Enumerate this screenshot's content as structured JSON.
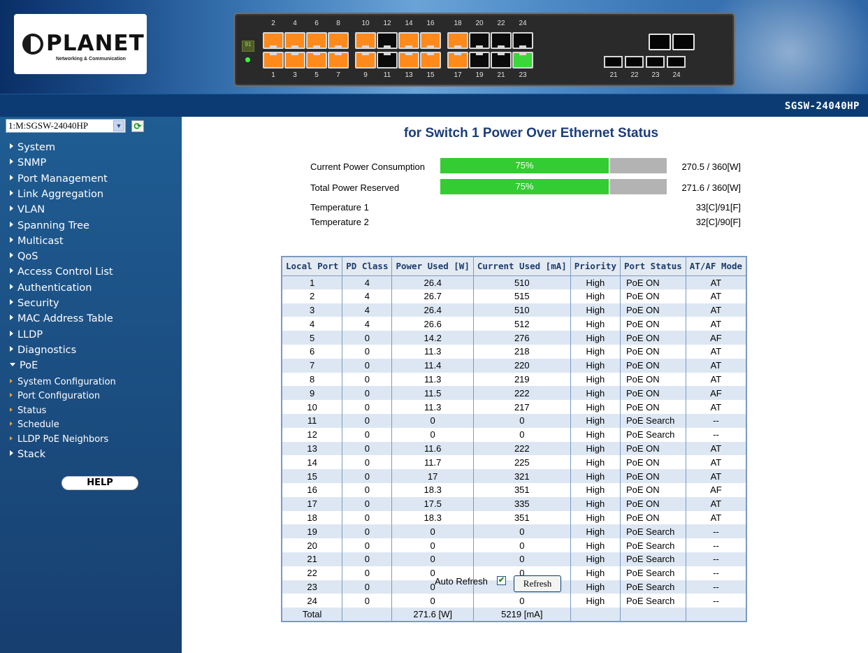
{
  "brand": {
    "name": "PLANET",
    "tagline": "Networking & Communication"
  },
  "faceplate": {
    "top_labels": [
      "2",
      "4",
      "6",
      "8",
      "10",
      "12",
      "14",
      "16",
      "18",
      "20",
      "22",
      "24"
    ],
    "bottom_labels": [
      "1",
      "3",
      "5",
      "7",
      "9",
      "11",
      "13",
      "15",
      "17",
      "19",
      "21",
      "23"
    ],
    "sfp_labels": [
      "21",
      "22",
      "23",
      "24"
    ],
    "top_states": [
      "on",
      "on",
      "on",
      "on",
      "on",
      "off",
      "on",
      "on",
      "on",
      "off",
      "off",
      "off"
    ],
    "bottom_states": [
      "on",
      "on",
      "on",
      "on",
      "on",
      "off",
      "on",
      "on",
      "on",
      "off",
      "off",
      "green"
    ],
    "led_label": "91"
  },
  "header": {
    "model": "SGSW-24040HP"
  },
  "sidebar": {
    "switch_select": "1:M:SGSW-24040HP",
    "items": [
      "System",
      "SNMP",
      "Port Management",
      "Link Aggregation",
      "VLAN",
      "Spanning Tree",
      "Multicast",
      "QoS",
      "Access Control List",
      "Authentication",
      "Security",
      "MAC Address Table",
      "LLDP",
      "Diagnostics",
      "PoE"
    ],
    "poe_subitems": [
      "System Configuration",
      "Port Configuration",
      "Status",
      "Schedule",
      "LLDP PoE Neighbors"
    ],
    "after_item": "Stack",
    "help": "HELP"
  },
  "main": {
    "title": "for Switch 1 Power Over Ethernet Status",
    "consumption": {
      "label": "Current Power Consumption",
      "percent": "75%",
      "value": "270.5 / 360[W]",
      "fill": 0.75
    },
    "reserved": {
      "label": "Total Power Reserved",
      "percent": "75%",
      "value": "271.6 / 360[W]",
      "fill": 0.75
    },
    "temp1": {
      "label": "Temperature 1",
      "value": "33[C]/91[F]"
    },
    "temp2": {
      "label": "Temperature 2",
      "value": "32[C]/90[F]"
    }
  },
  "table": {
    "headers": [
      "Local Port",
      "PD Class",
      "Power Used [W]",
      "Current Used [mA]",
      "Priority",
      "Port Status",
      "AT/AF Mode"
    ],
    "rows": [
      [
        "1",
        "4",
        "26.4",
        "510",
        "High",
        "PoE ON",
        "AT"
      ],
      [
        "2",
        "4",
        "26.7",
        "515",
        "High",
        "PoE ON",
        "AT"
      ],
      [
        "3",
        "4",
        "26.4",
        "510",
        "High",
        "PoE ON",
        "AT"
      ],
      [
        "4",
        "4",
        "26.6",
        "512",
        "High",
        "PoE ON",
        "AT"
      ],
      [
        "5",
        "0",
        "14.2",
        "276",
        "High",
        "PoE ON",
        "AF"
      ],
      [
        "6",
        "0",
        "11.3",
        "218",
        "High",
        "PoE ON",
        "AT"
      ],
      [
        "7",
        "0",
        "11.4",
        "220",
        "High",
        "PoE ON",
        "AT"
      ],
      [
        "8",
        "0",
        "11.3",
        "219",
        "High",
        "PoE ON",
        "AT"
      ],
      [
        "9",
        "0",
        "11.5",
        "222",
        "High",
        "PoE ON",
        "AF"
      ],
      [
        "10",
        "0",
        "11.3",
        "217",
        "High",
        "PoE ON",
        "AT"
      ],
      [
        "11",
        "0",
        "0",
        "0",
        "High",
        "PoE Search",
        "--"
      ],
      [
        "12",
        "0",
        "0",
        "0",
        "High",
        "PoE Search",
        "--"
      ],
      [
        "13",
        "0",
        "11.6",
        "222",
        "High",
        "PoE ON",
        "AT"
      ],
      [
        "14",
        "0",
        "11.7",
        "225",
        "High",
        "PoE ON",
        "AT"
      ],
      [
        "15",
        "0",
        "17",
        "321",
        "High",
        "PoE ON",
        "AT"
      ],
      [
        "16",
        "0",
        "18.3",
        "351",
        "High",
        "PoE ON",
        "AF"
      ],
      [
        "17",
        "0",
        "17.5",
        "335",
        "High",
        "PoE ON",
        "AT"
      ],
      [
        "18",
        "0",
        "18.3",
        "351",
        "High",
        "PoE ON",
        "AT"
      ],
      [
        "19",
        "0",
        "0",
        "0",
        "High",
        "PoE Search",
        "--"
      ],
      [
        "20",
        "0",
        "0",
        "0",
        "High",
        "PoE Search",
        "--"
      ],
      [
        "21",
        "0",
        "0",
        "0",
        "High",
        "PoE Search",
        "--"
      ],
      [
        "22",
        "0",
        "0",
        "0",
        "High",
        "PoE Search",
        "--"
      ],
      [
        "23",
        "0",
        "0",
        "0",
        "High",
        "PoE Search",
        "--"
      ],
      [
        "24",
        "0",
        "0",
        "0",
        "High",
        "PoE Search",
        "--"
      ]
    ],
    "total": {
      "label": "Total",
      "power": "271.6 [W]",
      "current": "5219 [mA]"
    }
  },
  "controls": {
    "auto_refresh_label": "Auto Refresh",
    "auto_refresh_checked": true,
    "refresh_button": "Refresh"
  }
}
